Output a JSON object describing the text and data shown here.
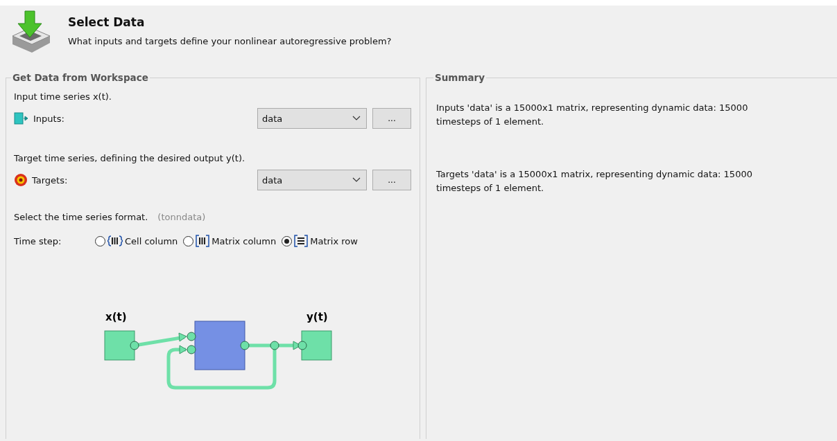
{
  "header": {
    "title": "Select Data",
    "subtitle": "What inputs and targets define your nonlinear autoregressive problem?"
  },
  "workspace": {
    "title": "Get Data from Workspace",
    "fields": [
      {
        "kind": "inputs",
        "description": "Input time series x(t).",
        "label": "Inputs:",
        "value": "data",
        "browse": "..."
      },
      {
        "kind": "targets",
        "description": "Target time series, defining the desired output y(t).",
        "label": "Targets:",
        "value": "data",
        "browse": "..."
      }
    ],
    "format": {
      "description": "Select the time series format.",
      "hint": "(tonndata)",
      "label": "Time step:",
      "options": [
        {
          "kind": "cell-column",
          "label": "Cell column",
          "selected": false
        },
        {
          "kind": "matrix-column",
          "label": "Matrix column",
          "selected": false
        },
        {
          "kind": "matrix-row",
          "label": "Matrix row",
          "selected": true
        }
      ]
    },
    "diagram": {
      "input_label": "x(t)",
      "output_label": "y(t)"
    }
  },
  "summary": {
    "title": "Summary",
    "lines": [
      "Inputs 'data' is a 15000x1 matrix, representing dynamic data: 15000 timesteps of 1 element.",
      "Targets 'data' is a 15000x1 matrix, representing dynamic data: 15000 timesteps of 1 element."
    ]
  }
}
